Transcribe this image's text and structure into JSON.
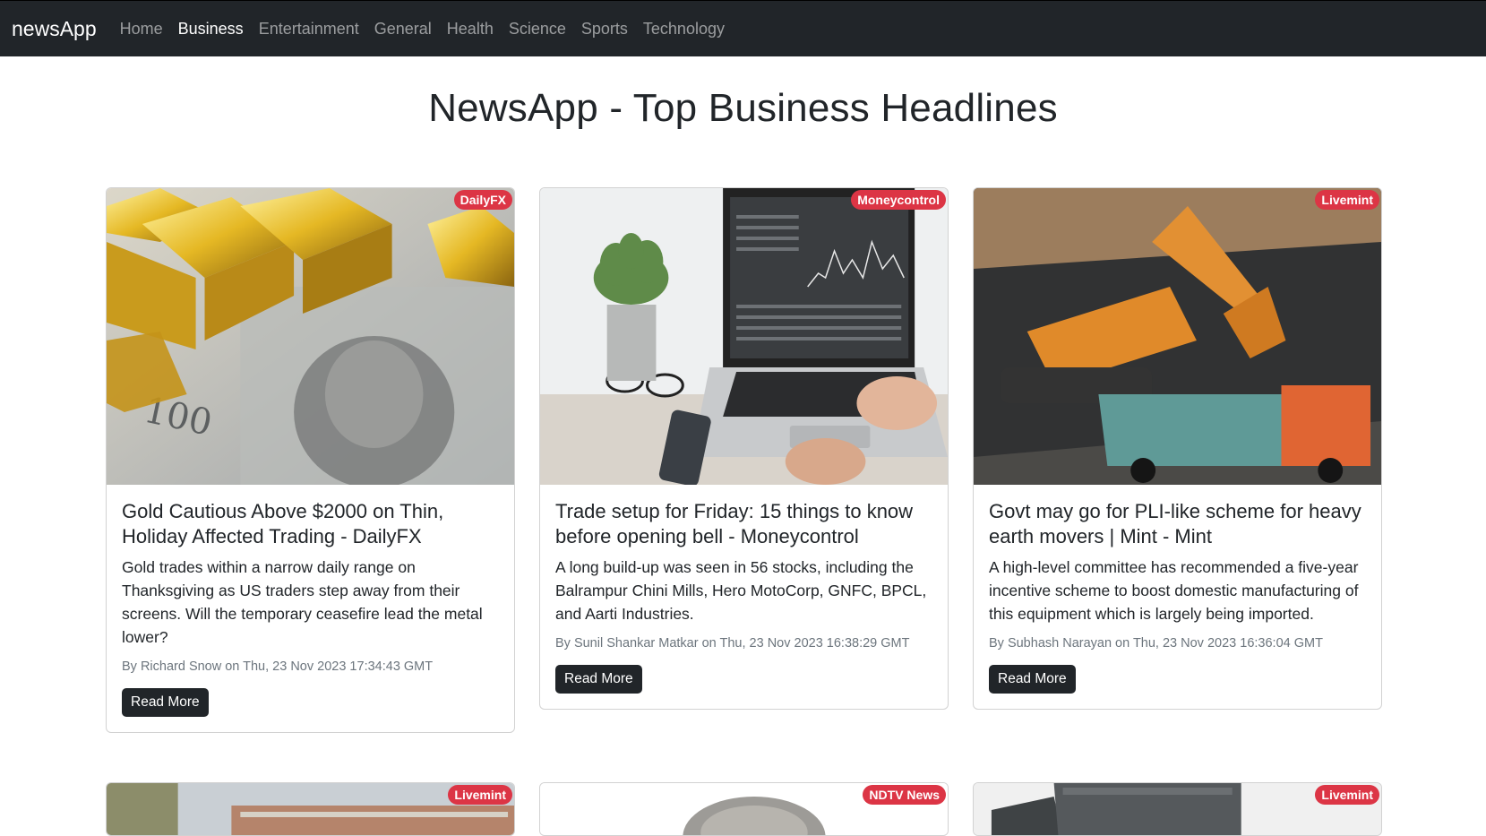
{
  "navbar": {
    "brand": "newsApp",
    "links": [
      {
        "label": "Home"
      },
      {
        "label": "Business"
      },
      {
        "label": "Entertainment"
      },
      {
        "label": "General"
      },
      {
        "label": "Health"
      },
      {
        "label": "Science"
      },
      {
        "label": "Sports"
      },
      {
        "label": "Technology"
      }
    ],
    "active": "Business"
  },
  "page": {
    "title": "NewsApp - Top Business Headlines"
  },
  "colors": {
    "navbar_bg": "#212529",
    "badge": "#dc3545",
    "button": "#212529"
  },
  "articles": [
    {
      "source": "DailyFX",
      "title": "Gold Cautious Above $2000 on Thin, Holiday Affected Trading - DailyFX",
      "description": "Gold trades within a narrow daily range on Thanksgiving as US traders step away from their screens. Will the temporary ceasefire lead the metal lower?",
      "meta": "By Richard Snow on Thu, 23 Nov 2023 17:34:43 GMT",
      "button": "Read More",
      "image_alt": "gold-bars-on-dollar-bills"
    },
    {
      "source": "Moneycontrol",
      "title": "Trade setup for Friday: 15 things to know before opening bell - Moneycontrol",
      "description": "A long build-up was seen in 56 stocks, including the Balrampur Chini Mills, Hero MotoCorp, GNFC, BPCL, and Aarti Industries.",
      "meta": "By Sunil Shankar Matkar on Thu, 23 Nov 2023 16:38:29 GMT",
      "button": "Read More",
      "image_alt": "laptop-trading-screen"
    },
    {
      "source": "Livemint",
      "title": "Govt may go for PLI-like scheme for heavy earth movers | Mint - Mint",
      "description": "A high-level committee has recommended a five-year incentive scheme to boost domestic manufacturing of this equipment which is largely being imported.",
      "meta": "By Subhash Narayan on Thu, 23 Nov 2023 16:36:04 GMT",
      "button": "Read More",
      "image_alt": "excavator-loading-truck"
    },
    {
      "source": "Livemint"
    },
    {
      "source": "NDTV News"
    },
    {
      "source": "Livemint"
    }
  ]
}
